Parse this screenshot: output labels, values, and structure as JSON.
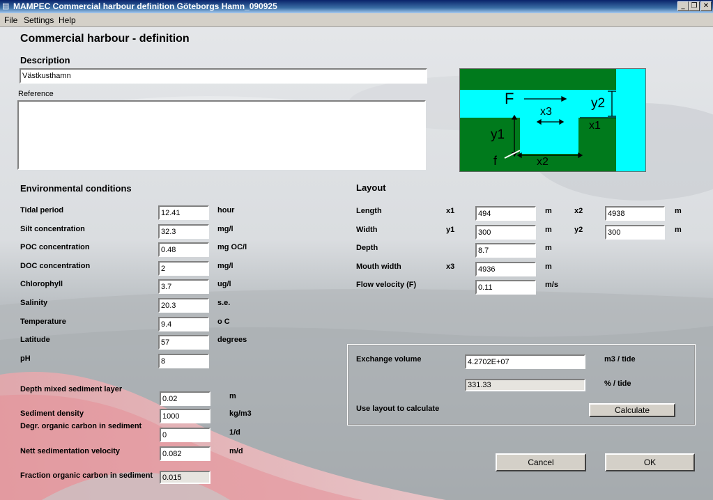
{
  "window": {
    "title": "MAMPEC Commercial harbour definition Göteborgs Hamn_090925",
    "app_icon": "app-icon",
    "controls": [
      "minimize-icon",
      "maximize-icon",
      "close-icon"
    ]
  },
  "menu": {
    "items": [
      "File",
      "Settings",
      "Help"
    ]
  },
  "page": {
    "title": "Commercial harbour - definition",
    "description_label": "Description",
    "description_value": "Västkusthamn",
    "reference_label": "Reference",
    "reference_value": ""
  },
  "environment": {
    "heading": "Environmental conditions",
    "fields": [
      {
        "label": "Tidal period",
        "value": "12.41",
        "unit": "hour"
      },
      {
        "label": "Silt concentration",
        "value": "32.3",
        "unit": "mg/l"
      },
      {
        "label": "POC concentration",
        "value": "0.48",
        "unit": "mg OC/l"
      },
      {
        "label": "DOC concentration",
        "value": "2",
        "unit": "mg/l"
      },
      {
        "label": "Chlorophyll",
        "value": "3.7",
        "unit": "ug/l"
      },
      {
        "label": "Salinity",
        "value": "20.3",
        "unit": "s.e."
      },
      {
        "label": "Temperature",
        "value": "9.4",
        "unit": "o C"
      },
      {
        "label": "Latitude",
        "value": "57",
        "unit": "degrees"
      },
      {
        "label": "pH",
        "value": "8",
        "unit": ""
      }
    ],
    "sediment": [
      {
        "label": "Depth mixed sediment layer",
        "value": "0.02",
        "unit": "m"
      },
      {
        "label": "Sediment density",
        "value": "1000",
        "unit": "kg/m3"
      },
      {
        "label": "Degr. organic carbon in sediment",
        "value": "0",
        "unit": "1/d"
      },
      {
        "label": "Nett sedimentation velocity",
        "value": "0.082",
        "unit": "m/d"
      },
      {
        "label": "Fraction organic carbon in sediment",
        "value": "0.015",
        "unit": ""
      }
    ]
  },
  "layout": {
    "heading": "Layout",
    "length": {
      "label": "Length",
      "sym1": "x1",
      "val1": "494",
      "unit1": "m",
      "sym2": "x2",
      "val2": "4938",
      "unit2": "m"
    },
    "width": {
      "label": "Width",
      "sym1": "y1",
      "val1": "300",
      "unit1": "m",
      "sym2": "y2",
      "val2": "300",
      "unit2": "m"
    },
    "depth": {
      "label": "Depth",
      "value": "8.7",
      "unit": "m"
    },
    "mouth": {
      "label": "Mouth width",
      "sym": "x3",
      "value": "4936",
      "unit": "m"
    },
    "flow": {
      "label": "Flow velocity (F)",
      "value": "0.11",
      "unit": "m/s"
    }
  },
  "exchange": {
    "volume_label": "Exchange volume",
    "volume_value": "4.2702E+07",
    "volume_unit": "m3 / tide",
    "percent_value": "331.33",
    "percent_unit": "% / tide",
    "calc_label": "Use layout to calculate",
    "calc_button": "Calculate"
  },
  "diagram": {
    "labels": {
      "F": "F",
      "y2": "y2",
      "x3": "x3",
      "x1": "x1",
      "y1": "y1",
      "f": "f",
      "x2": "x2"
    },
    "colors": {
      "land": "#007a1c",
      "water": "#00ffff"
    }
  },
  "buttons": {
    "cancel": "Cancel",
    "ok": "OK"
  },
  "colors": {
    "title_start": "#0a246a",
    "title_end": "#a6caf0",
    "face": "#d4d0c8"
  }
}
